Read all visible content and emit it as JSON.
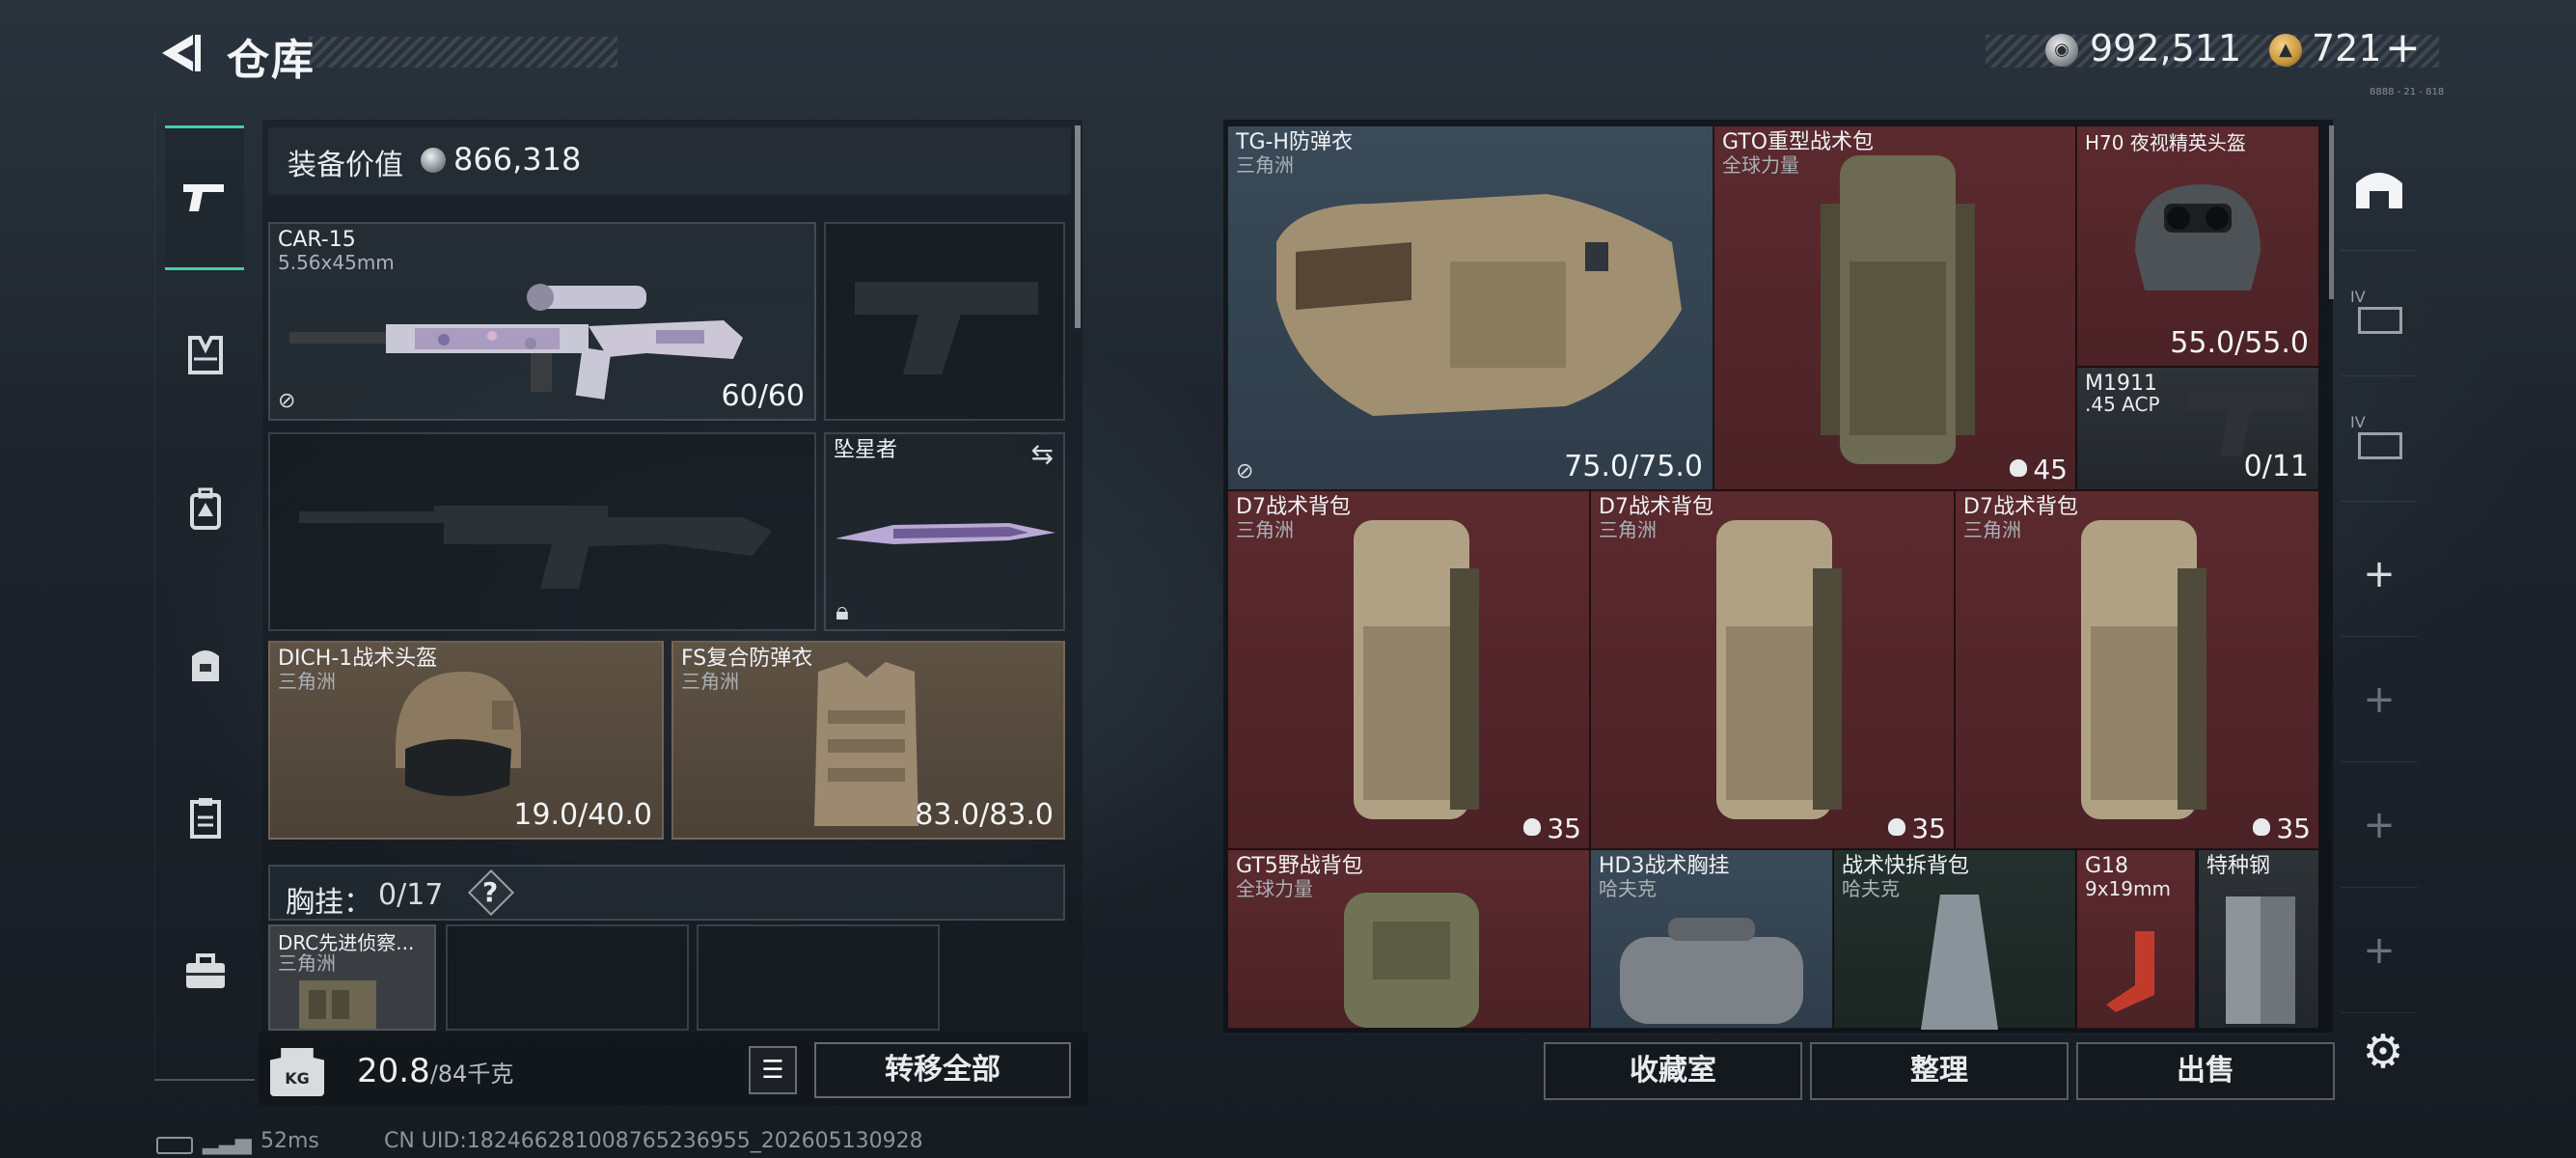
{
  "header": {
    "title": "仓库",
    "currency_silver": "992,511",
    "currency_gold": "721",
    "currency_plus": "+",
    "version": "8888 - 21 - 818"
  },
  "left_rail": {
    "items": [
      {
        "name": "weapon",
        "icon": "pistol-icon",
        "active": true
      },
      {
        "name": "armor",
        "icon": "vest-icon"
      },
      {
        "name": "backpack",
        "icon": "backpack-icon"
      },
      {
        "name": "bag",
        "icon": "bag-icon"
      },
      {
        "name": "clipboard",
        "icon": "clipboard-icon"
      },
      {
        "name": "toolbox",
        "icon": "toolbox-icon"
      }
    ]
  },
  "equipment": {
    "value_label": "装备价值",
    "value": "866,318",
    "primary_weapon": {
      "name": "CAR-15",
      "caliber": "5.56x45mm",
      "ammo": "60/60"
    },
    "melee": {
      "name": "坠星者"
    },
    "helmet": {
      "name": "DICH-1战术头盔",
      "brand": "三角洲",
      "durability": "19.0/40.0"
    },
    "armor": {
      "name": "FS复合防弹衣",
      "brand": "三角洲",
      "durability": "83.0/83.0"
    },
    "chest_rig_label": "胸挂：",
    "chest_rig_capacity": "0/17",
    "chest_rig_help": "?",
    "chest_rig_item": {
      "name": "DRC先进侦察...",
      "brand": "三角洲"
    }
  },
  "weight": {
    "current": "20.8",
    "max": "/84千克",
    "kg_label": "KG"
  },
  "buttons": {
    "transfer_all": "转移全部",
    "collection": "收藏室",
    "organize": "整理",
    "sell": "出售"
  },
  "storage": [
    {
      "name": "TG-H防弹衣",
      "brand": "三角洲",
      "value": "75.0/75.0"
    },
    {
      "name": "GTO重型战术包",
      "brand": "全球力量",
      "count": "45"
    },
    {
      "name": "H70 夜视精英头盔",
      "brand": "",
      "value": "55.0/55.0"
    },
    {
      "name": "M1911",
      "brand": ".45 ACP",
      "value": "0/11"
    },
    {
      "name": "D7战术背包",
      "brand": "三角洲",
      "count": "35"
    },
    {
      "name": "D7战术背包",
      "brand": "三角洲",
      "count": "35"
    },
    {
      "name": "D7战术背包",
      "brand": "三角洲",
      "count": "35"
    },
    {
      "name": "GT5野战背包",
      "brand": "全球力量"
    },
    {
      "name": "HD3战术胸挂",
      "brand": "哈夫克"
    },
    {
      "name": "战术快拆背包",
      "brand": "哈夫克"
    },
    {
      "name": "G18",
      "brand": "9x19mm"
    },
    {
      "name": "特种钢",
      "brand": ""
    }
  ],
  "right_rail": {
    "items": [
      "home-icon",
      "storage-box-icon",
      "storage-box-icon",
      "plus",
      "plus",
      "plus",
      "plus"
    ],
    "roman_1": "IV",
    "roman_2": "IV"
  },
  "status": {
    "ping": "52ms",
    "uid": "CN UID:18246628100876523695​5_202605130928"
  },
  "colors": {
    "accent_green": "#3fd0a8",
    "slot_red": "#5b2a2e",
    "slot_blue": "#3a4a58",
    "slot_brown": "#5e5244"
  }
}
